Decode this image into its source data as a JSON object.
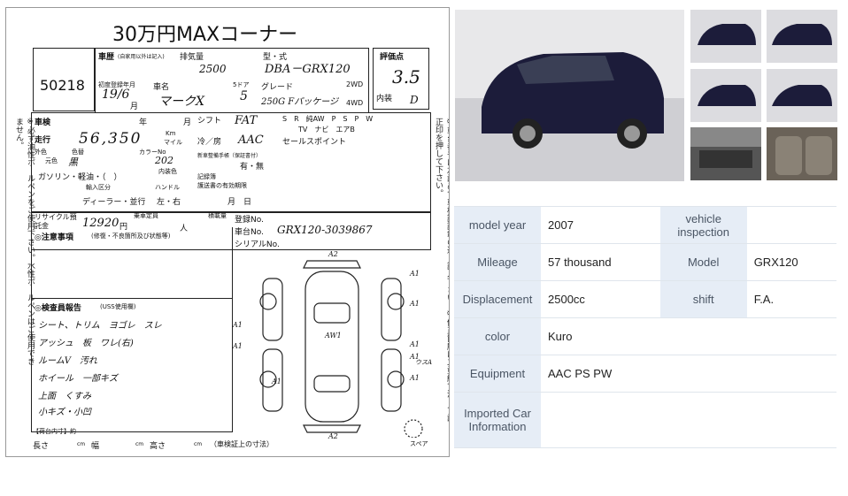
{
  "sheet": {
    "title": "30万円MAXコーナー",
    "lot": "50218",
    "car_history_label": "車歴",
    "car_history_note": "(自家用以外は記入)",
    "displacement_label": "排気量",
    "displacement_value": "2500",
    "model_type_label": "型・式",
    "model_type_value": "DBA－GRX120",
    "rating_label": "評価点",
    "rating_value": "3.5",
    "first_reg_label": "初度登録年月",
    "first_reg_value": "19/6",
    "month_label": "月",
    "car_name_label": "車名",
    "car_name_value": "マークX",
    "doors_label": "5ドア",
    "doors_value": "5",
    "grade_label": "グレード",
    "grade_value": "250G Fパッケージ",
    "wd2_label": "2WD",
    "wd4_label": "4WD",
    "interior_label": "内装",
    "interior_value": "D",
    "shaken_label": "車検",
    "year_label": "年",
    "shift_label": "シフト",
    "shift_value": "FAT",
    "equip_row1": "S　R　純AW　P　S　P　W",
    "equip_row2": "TV　ナビ　エアB",
    "mileage_label": "走行",
    "mileage_value": "56,350",
    "km_label": "Km",
    "mile_label": "マイル",
    "ac_label": "冷／房",
    "ac_value": "AAC",
    "sales_point_label": "セールスポイント",
    "exterior_label": "外色",
    "color_label": "色替",
    "orig_color_label": "元色",
    "orig_color_value": "黒",
    "color_no_label": "カラーNo",
    "color_no_value": "202",
    "warranty_label": "新車整備手帳（保証書付）",
    "warranty_value": "有・無",
    "fuel_label": "ガソリン・軽油・（　）",
    "inner_color_label": "内装色",
    "record_label": "記録簿",
    "record_period_label": "護送書の有効期限",
    "day_label": "月　日",
    "import_label": "輸入区分",
    "handle_label": "ハンドル",
    "import_value": "ディーラー・並行",
    "handle_value": "左・右",
    "recycle_label": "リサイクル預託金",
    "recycle_value": "12920",
    "yen_label": "円",
    "capacity_label": "乗車定員",
    "capacity_unit": "人",
    "load_label": "積載量",
    "reg_no_label": "登録No.",
    "chassis_label": "車台No.",
    "chassis_value": "GRX120-3039867",
    "serial_label": "シリアルNo.",
    "notes_label": "◎注意事項",
    "notes_sub": "(修復・不良箇所及び状態等)",
    "inspector_label": "◎検査員報告",
    "inspector_sub": "(USS使用欄)",
    "report_lines": [
      "シート、トリム　ヨゴレ　スレ",
      "アッシュ　板　ワレ(右)",
      "ルームV　汚れ",
      "ホイール　一部キズ",
      "上面　くすみ",
      "小キズ・小凹"
    ],
    "damage_marks": [
      "A2",
      "A1",
      "A1",
      "A1",
      "A1",
      "AW1",
      "A1",
      "A1",
      "A1",
      "A1",
      "A2"
    ],
    "ga_label": "ウスA",
    "spare_label": "スペア",
    "bed_label": "【荷台内寸】約",
    "length_label": "長さ",
    "width_label": "幅",
    "height_label": "高さ",
    "cm": "cm",
    "chassis_upper_label": "（車検証上の寸法）",
    "left_note": "※必ず油性ボールペンをご使用下さい。水性ボールペンはご使用できません。",
    "right_note": "※車台番号は左詰めで車検証記載の通り記入下さい。※修正箇所は二重線で消して訂正印を押して下さい。"
  },
  "specs": [
    {
      "k1": "model year",
      "v1": "2007",
      "k2": "vehicle inspection",
      "v2": ""
    },
    {
      "k1": "Mileage",
      "v1": "57 thousand",
      "k2": "Model",
      "v2": "GRX120"
    },
    {
      "k1": "Displacement",
      "v1": "2500cc",
      "k2": "shift",
      "v2": "F.A."
    },
    {
      "k1": "color",
      "v1": "Kuro",
      "k2": "",
      "v2": ""
    },
    {
      "k1": "Equipment",
      "v1": "AAC PS PW",
      "k2": "",
      "v2": ""
    },
    {
      "k1": "Imported Car Information",
      "v1": "",
      "k2": "",
      "v2": ""
    }
  ],
  "colors": {
    "car_body": "#1c1c3a",
    "label_bg": "#e6edf6",
    "label_text": "#4a5564"
  }
}
